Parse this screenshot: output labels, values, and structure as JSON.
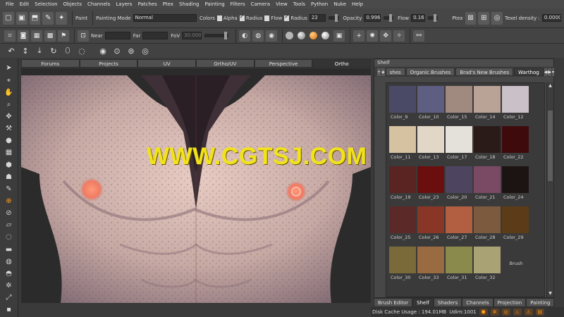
{
  "menu": [
    "File",
    "Edit",
    "Selection",
    "Objects",
    "Channels",
    "Layers",
    "Patches",
    "Ptex",
    "Shading",
    "Painting",
    "Filters",
    "Camera",
    "View",
    "Tools",
    "Python",
    "Nuke",
    "Help"
  ],
  "toolbar": {
    "paint_label": "Paint",
    "painting_mode_label": "Painting Mode",
    "painting_mode_value": "Normal",
    "colors_label": "Colors",
    "alpha_label": "Alpha",
    "radius_check_label": "Radius",
    "flow_check_label": "Flow",
    "radius_label": "Radius",
    "radius_value": "22",
    "opacity_label": "Opacity",
    "opacity_value": "0.996",
    "flow_label": "Flow",
    "flow_value": "0.160",
    "ptex_label": "Ptex",
    "texel_label": "Texel density :",
    "texel_value": "0.0000"
  },
  "toolbar2": {
    "near_label": "Near",
    "far_label": "Far",
    "fov_label": "FoV",
    "fov_value": "30.000"
  },
  "view_tabs": [
    "Forums",
    "Projects",
    "UV",
    "Ortho/UV",
    "Perspective",
    "Ortho"
  ],
  "watermark": "WWW.CGTSJ.COM",
  "shelf": {
    "title": "Shelf",
    "tabs": [
      "shes",
      "Organic Brushes",
      "Brad's New Brushes",
      "Warthog"
    ],
    "swatches": [
      {
        "name": "Color_9",
        "color": "#4b4a66"
      },
      {
        "name": "Color_10",
        "color": "#5d5e82"
      },
      {
        "name": "Color_15",
        "color": "#a08a80"
      },
      {
        "name": "Color_14",
        "color": "#b9a397"
      },
      {
        "name": "Color_12",
        "color": "#c9c0c8"
      },
      {
        "name": "Color_11",
        "color": "#d6c2a1"
      },
      {
        "name": "Color_13",
        "color": "#e2d7c7"
      },
      {
        "name": "Color_17",
        "color": "#e4e0da"
      },
      {
        "name": "Color_18",
        "color": "#2a1a18"
      },
      {
        "name": "Color_22",
        "color": "#3e0a0c"
      },
      {
        "name": "Color_19",
        "color": "#5a2422"
      },
      {
        "name": "Color_23",
        "color": "#6b0f0e"
      },
      {
        "name": "Color_20",
        "color": "#4d4560"
      },
      {
        "name": "Color_21",
        "color": "#7a4a64"
      },
      {
        "name": "Color_24",
        "color": "#1c1412"
      },
      {
        "name": "Color_25",
        "color": "#5b2a28"
      },
      {
        "name": "Color_26",
        "color": "#8a3626"
      },
      {
        "name": "Color_27",
        "color": "#b25e40"
      },
      {
        "name": "Color_28",
        "color": "#7c5a3e"
      },
      {
        "name": "Color_29",
        "color": "#5c3c18"
      },
      {
        "name": "Color_30",
        "color": "#7a6a3a"
      },
      {
        "name": "Color_33",
        "color": "#9a6a40"
      },
      {
        "name": "Color_31",
        "color": "#8a8a4c"
      },
      {
        "name": "Color_32",
        "color": "#a8a274"
      },
      {
        "name": "Brush",
        "color": ""
      }
    ]
  },
  "bottom_tabs": [
    "Brush Editor",
    "Shelf",
    "Shaders",
    "Channels",
    "Projection",
    "Painting"
  ],
  "status": {
    "disk_cache": "Disk Cache Usage : 194.01MB",
    "udim": "Udim:1001"
  },
  "icons": {
    "accent": "#ff9c1a"
  }
}
